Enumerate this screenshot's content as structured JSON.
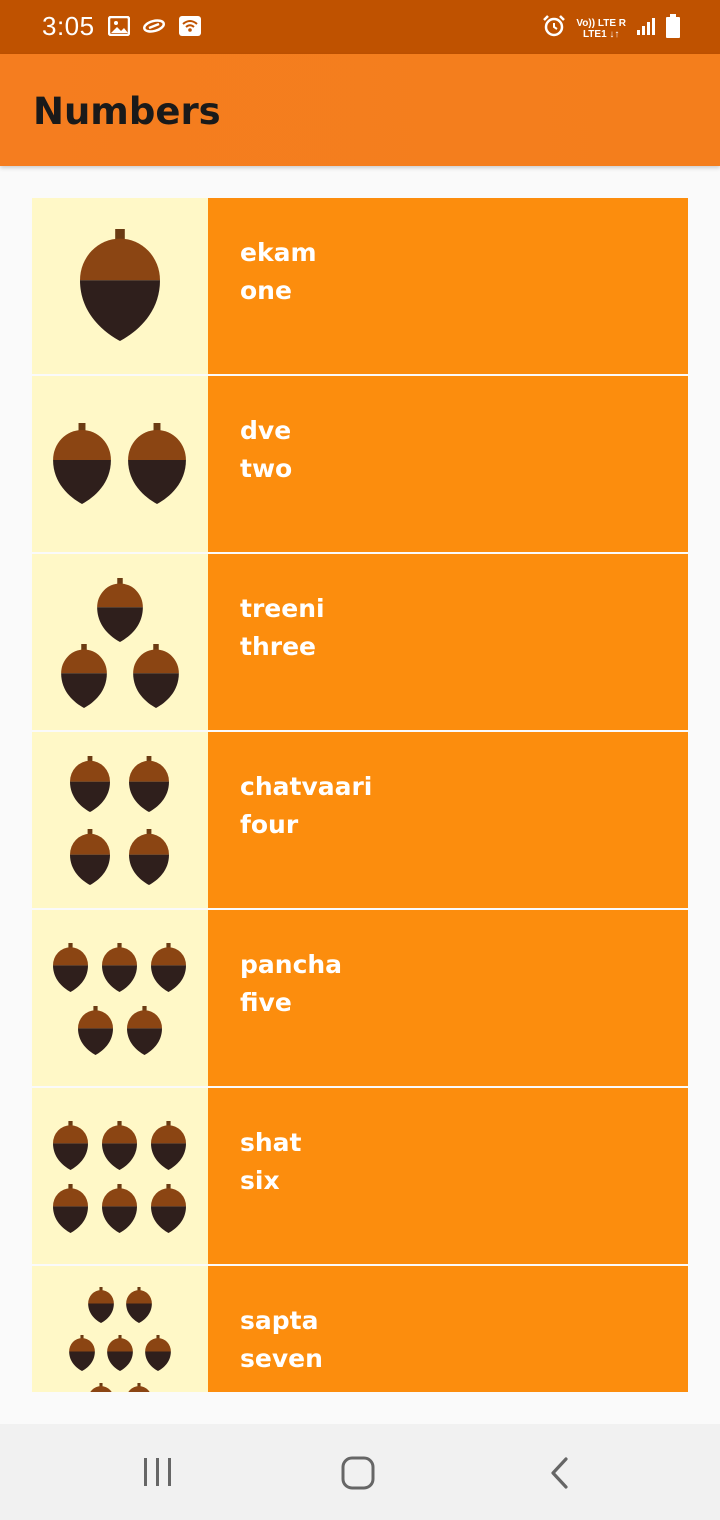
{
  "status_bar": {
    "time": "3:05",
    "network_label_top": "Vo)) LTE R",
    "network_label_bottom": "LTE1 ↓↑",
    "icons": [
      "image-icon",
      "link-icon",
      "wifi-icon",
      "alarm-icon",
      "signal-icon",
      "battery-icon"
    ]
  },
  "app_bar": {
    "title": "Numbers"
  },
  "numbers": [
    {
      "sanskrit": "ekam",
      "english": "one",
      "count": 1
    },
    {
      "sanskrit": "dve",
      "english": "two",
      "count": 2
    },
    {
      "sanskrit": "treeni",
      "english": "three",
      "count": 3
    },
    {
      "sanskrit": "chatvaari",
      "english": "four",
      "count": 4
    },
    {
      "sanskrit": "pancha",
      "english": "five",
      "count": 5
    },
    {
      "sanskrit": "shat",
      "english": "six",
      "count": 6
    },
    {
      "sanskrit": "sapta",
      "english": "seven",
      "count": 7
    }
  ],
  "colors": {
    "status_bar": "#bf5200",
    "app_bar": "#f57d1f",
    "row_text_bg": "#fc8d0d",
    "row_image_bg": "#fff8c7",
    "acorn_cap": "#8b4513",
    "acorn_body": "#2f1f1c"
  },
  "navigation": {
    "icons": [
      "recent-apps-icon",
      "home-icon",
      "back-icon"
    ]
  }
}
